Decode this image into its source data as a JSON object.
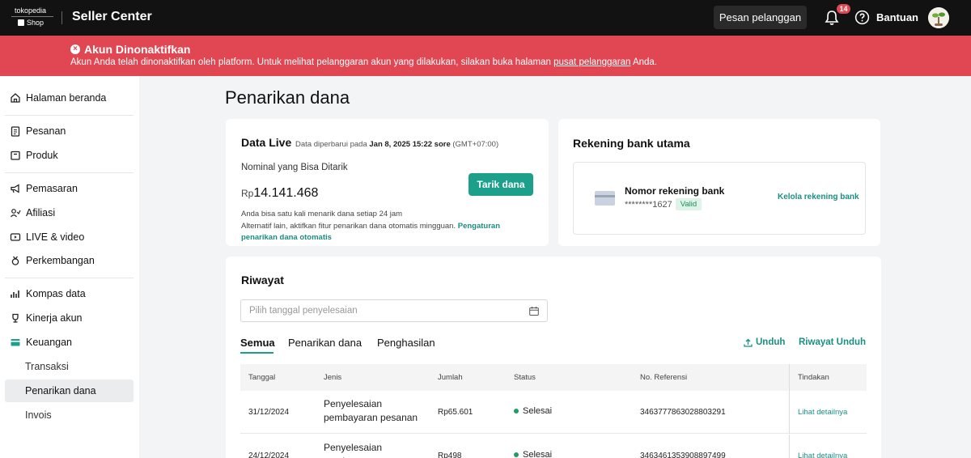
{
  "header": {
    "logo_top": "tokopedia",
    "logo_bottom": "Shop",
    "title": "Seller Center",
    "pesan_button": "Pesan pelanggan",
    "notif_count": "14",
    "help_label": "Bantuan"
  },
  "alert": {
    "title": "Akun Dinonaktifkan",
    "text_before": "Akun Anda telah dinonaktifkan oleh platform. Untuk melihat pelanggaran akun yang dilakukan, silakan buka halaman ",
    "link": "pusat pelanggaran",
    "text_after": " Anda.",
    "color": "#e04753"
  },
  "sidebar": {
    "items": [
      {
        "label": "Halaman beranda",
        "icon": "home-icon"
      },
      {
        "label": "Pesanan",
        "icon": "clipboard-icon"
      },
      {
        "label": "Produk",
        "icon": "box-icon"
      },
      {
        "label": "Pemasaran",
        "icon": "megaphone-icon"
      },
      {
        "label": "Afiliasi",
        "icon": "people-icon"
      },
      {
        "label": "LIVE & video",
        "icon": "video-icon"
      },
      {
        "label": "Perkembangan",
        "icon": "medal-icon"
      },
      {
        "label": "Kompas data",
        "icon": "chart-icon"
      },
      {
        "label": "Kinerja akun",
        "icon": "trophy-icon"
      },
      {
        "label": "Keuangan",
        "icon": "wallet-icon"
      }
    ],
    "sub_items": [
      "Transaksi",
      "Penarikan dana",
      "Invois"
    ],
    "active_sub": "Penarikan dana"
  },
  "page": {
    "title": "Penarikan dana"
  },
  "live": {
    "title": "Data Live",
    "updated_prefix": "Data diperbarui pada ",
    "updated_date": "Jan 8, 2025 15:22 sore",
    "updated_tz": " (GMT+07:00)",
    "nominal_label": "Nominal yang Bisa Ditarik",
    "currency": "Rp",
    "amount": "14.141.468",
    "withdraw_button": "Tarik dana",
    "info1": "Anda bisa satu kali menarik dana setiap 24 jam",
    "info2": "Alternatif lain, aktifkan fitur penarikan dana otomatis mingguan. ",
    "info2_link": "Pengaturan penarikan dana otomatis"
  },
  "bank": {
    "title": "Rekening bank utama",
    "label": "Nomor rekening bank",
    "number": "********1627",
    "status": "Valid",
    "manage_link": "Kelola rekening bank"
  },
  "history": {
    "title": "Riwayat",
    "date_placeholder": "Pilih tanggal penyelesaian",
    "tabs": [
      "Semua",
      "Penarikan dana",
      "Penghasilan"
    ],
    "active_tab": "Semua",
    "download": "Unduh",
    "download_history": "Riwayat Unduh",
    "columns": [
      "Tanggal",
      "Jenis",
      "Jumlah",
      "Status",
      "No. Referensi",
      "Tindakan"
    ],
    "rows": [
      {
        "date": "31/12/2024",
        "type": "Penyelesaian pembayaran pesanan",
        "amount": "Rp65.601",
        "status": "Selesai",
        "ref": "3463777863028803291",
        "action": "Lihat detailnya"
      },
      {
        "date": "24/12/2024",
        "type": "Penyelesaian pembayaran pesanan",
        "amount": "Rp498",
        "status": "Selesai",
        "ref": "3463461353908897499",
        "action": "Lihat detailnya"
      }
    ]
  },
  "colors": {
    "accent": "#1ca08c",
    "status_done": "#1aa067",
    "topbar": "#121212"
  }
}
